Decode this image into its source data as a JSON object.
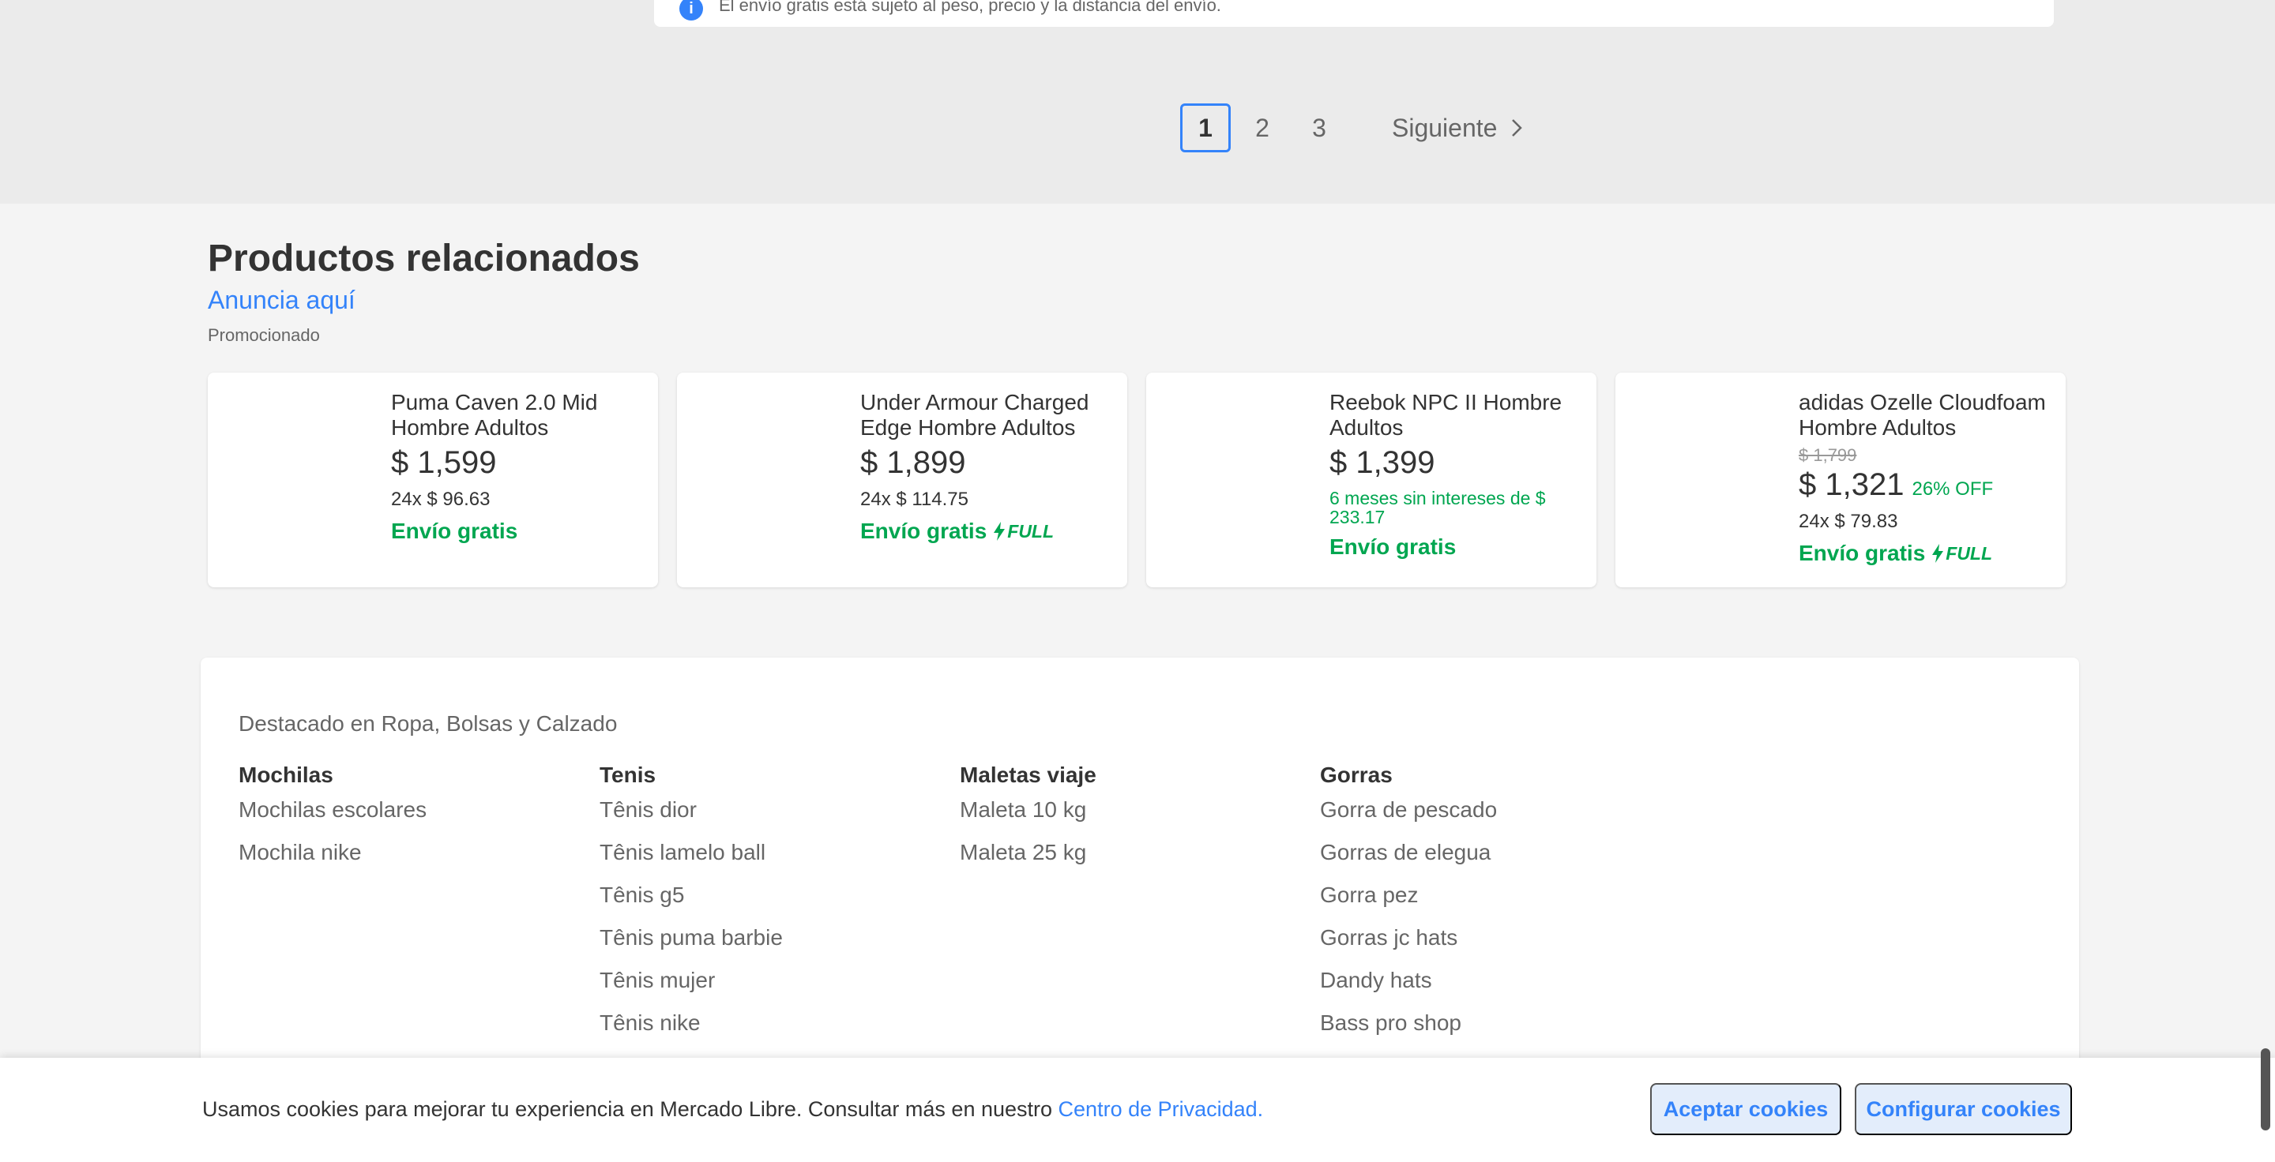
{
  "notice": {
    "icon": "info-icon",
    "icon_glyph": "i",
    "text": "El envío gratis está sujeto al peso, precio y la distancia del envío."
  },
  "pagination": {
    "pages": [
      "1",
      "2",
      "3"
    ],
    "current": "1",
    "next_label": "Siguiente"
  },
  "related": {
    "title": "Productos relacionados",
    "ad_link": "Anuncia aquí",
    "promoted": "Promocionado",
    "products": [
      {
        "title": "Puma Caven 2.0 Mid Hombre Adultos",
        "price": "$ 1,599",
        "installments": "24x $ 96.63",
        "shipping": "Envío gratis"
      },
      {
        "title": "Under Armour Charged Edge Hombre Adultos",
        "price": "$ 1,899",
        "installments": "24x $ 114.75",
        "shipping": "Envío gratis",
        "full_label": "FULL"
      },
      {
        "title": "Reebok NPC II Hombre Adultos",
        "price": "$ 1,399",
        "installments_interest_free": "6 meses sin intereses de $ 233.17",
        "shipping": "Envío gratis"
      },
      {
        "title": "adidas Ozelle Cloudfoam Hombre Adultos",
        "old_price": "$ 1,799",
        "price": "$ 1,321",
        "discount": "26% OFF",
        "installments": "24x $ 79.83",
        "shipping": "Envío gratis",
        "full_label": "FULL"
      }
    ]
  },
  "featured": {
    "title": "Destacado en Ropa, Bolsas y Calzado",
    "columns": [
      {
        "heading": "Mochilas",
        "links": [
          "Mochilas escolares",
          "Mochila nike"
        ]
      },
      {
        "heading": "Tenis",
        "links": [
          "Tênis dior",
          "Tênis lamelo ball",
          "Tênis g5",
          "Tênis puma barbie",
          "Tênis mujer",
          "Tênis nike"
        ]
      },
      {
        "heading": "Maletas viaje",
        "links": [
          "Maleta 10 kg",
          "Maleta 25 kg"
        ]
      },
      {
        "heading": "Gorras",
        "links": [
          "Gorra de pescado",
          "Gorras de elegua",
          "Gorra pez",
          "Gorras jc hats",
          "Dandy hats",
          "Bass pro shop"
        ]
      }
    ]
  },
  "cookies": {
    "text": "Usamos cookies para mejorar tu experiencia en Mercado Libre. Consultar más en nuestro",
    "link": "Centro de Privacidad.",
    "accept": "Aceptar cookies",
    "configure": "Configurar cookies"
  },
  "colors": {
    "accent": "#3483fa",
    "success": "#00a650",
    "band": "#ebebeb",
    "background": "#f4f4f4"
  }
}
